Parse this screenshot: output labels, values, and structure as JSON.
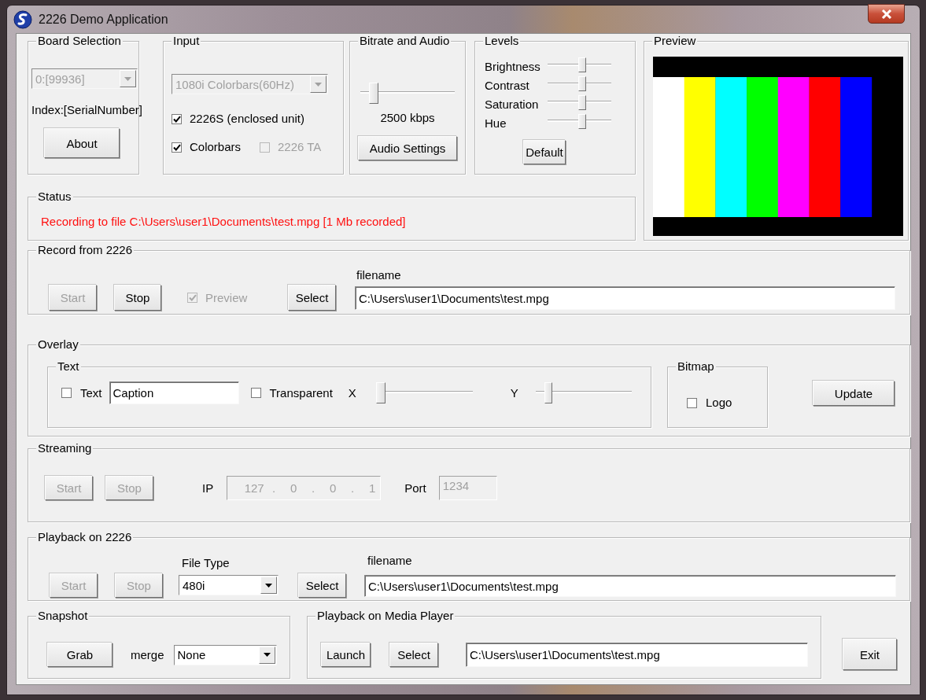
{
  "window": {
    "title": "2226 Demo Application"
  },
  "board_selection": {
    "title": "Board Selection",
    "board": {
      "value": "0:[99936]",
      "disabled": true
    },
    "index_label": "Index:[SerialNumber]",
    "about_button": "About"
  },
  "input": {
    "title": "Input",
    "source": {
      "value": "1080i Colorbars(60Hz)",
      "disabled": true
    },
    "checkboxes": [
      {
        "label": "2226S (enclosed unit)",
        "checked": true,
        "disabled": false
      },
      {
        "label": "Colorbars",
        "checked": true,
        "disabled": false
      },
      {
        "label": "2226 TA",
        "checked": false,
        "disabled": true
      }
    ]
  },
  "bitrate_audio": {
    "title": "Bitrate and Audio",
    "bitrate": {
      "level": 0.1
    },
    "reading": "2500 kbps",
    "audio_button": "Audio Settings"
  },
  "levels": {
    "title": "Levels",
    "sliders": [
      {
        "label": "Brightness",
        "level": 0.55
      },
      {
        "label": "Contrast",
        "level": 0.55
      },
      {
        "label": "Saturation",
        "level": 0.55
      },
      {
        "label": "Hue",
        "level": 0.55
      }
    ],
    "default_button": "Default"
  },
  "preview": {
    "title": "Preview"
  },
  "status": {
    "title": "Status",
    "message": "Recording to file C:\\Users\\user1\\Documents\\test.mpg [1 Mb recorded]"
  },
  "record": {
    "title": "Record from 2226",
    "buttons": [
      {
        "label": "Start",
        "disabled": true
      },
      {
        "label": "Stop",
        "disabled": false
      }
    ],
    "preview_checkbox": {
      "label": "Preview",
      "checked": true,
      "disabled": true
    },
    "select_button": "Select",
    "filename_label": "filename",
    "filename": "C:\\Users\\user1\\Documents\\test.mpg"
  },
  "overlay": {
    "title": "Overlay",
    "text_group": {
      "title": "Text",
      "text_checkbox": {
        "label": "Text",
        "checked": false
      },
      "caption": "Caption",
      "transparent_checkbox": {
        "label": "Transparent",
        "checked": false
      },
      "x_label": "X",
      "x_slider": {
        "level": 0
      },
      "y_label": "Y",
      "y_slider": {
        "level": 0.1
      }
    },
    "bitmap_group": {
      "title": "Bitmap",
      "logo_checkbox": {
        "label": "Logo",
        "checked": false
      }
    },
    "update_button": "Update"
  },
  "streaming": {
    "title": "Streaming",
    "buttons": [
      {
        "label": "Start",
        "disabled": true
      },
      {
        "label": "Stop",
        "disabled": true
      }
    ],
    "ip_label": "IP",
    "ip_parts": [
      "127",
      ".",
      "0",
      ".",
      "0",
      ".",
      "1"
    ],
    "port_label": "Port",
    "port": "1234"
  },
  "playback": {
    "title": "Playback on 2226",
    "buttons": [
      {
        "label": "Start",
        "disabled": true
      },
      {
        "label": "Stop",
        "disabled": true
      }
    ],
    "file_type_label": "File Type",
    "file_type": "480i",
    "select_button": "Select",
    "filename_label": "filename",
    "filename": "C:\\Users\\user1\\Documents\\test.mpg"
  },
  "snapshot": {
    "title": "Snapshot",
    "grab_button": "Grab",
    "merge_label": "merge",
    "merge": "None"
  },
  "media_player": {
    "title": "Playback on Media Player",
    "launch_button": "Launch",
    "select_button": "Select",
    "filename": "C:\\Users\\user1\\Documents\\test.mpg"
  },
  "exit_button": "Exit"
}
